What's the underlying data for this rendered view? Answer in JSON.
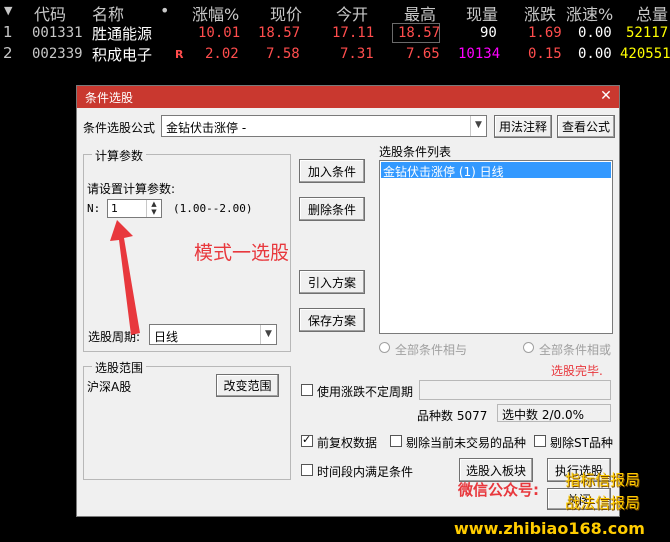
{
  "table": {
    "headers": [
      "代码",
      "名称",
      "•",
      "涨幅%",
      "现价",
      "今开",
      "最高",
      "现量",
      "涨跌",
      "涨速%",
      "总量"
    ],
    "rows": [
      {
        "idx": "1",
        "code": "001331",
        "name": "胜通能源",
        "flag": "",
        "pct": "10.01",
        "price": "18.57",
        "open": "17.11",
        "high": "18.57",
        "vol": "90",
        "chg": "1.69",
        "speed": "0.00",
        "total": "52117"
      },
      {
        "idx": "2",
        "code": "002339",
        "name": "积成电子",
        "flag": "R",
        "pct": "2.02",
        "price": "7.58",
        "open": "7.31",
        "high": "7.65",
        "vol": "10134",
        "chg": "0.15",
        "speed": "0.00",
        "total": "420551"
      }
    ]
  },
  "dialog": {
    "title": "条件选股",
    "formula_label": "条件选股公式",
    "formula_value": "金钻伏击涨停 -",
    "usage_button": "用法注释",
    "view_button": "查看公式",
    "params_group": "计算参数",
    "params_prompt": "请设置计算参数:",
    "param_n_label": "N:",
    "param_n_value": "1",
    "param_n_range": "(1.00--2.00)",
    "add_button": "加入条件",
    "delete_button": "删除条件",
    "import_button": "引入方案",
    "save_button": "保存方案",
    "list_label": "选股条件列表",
    "conditions": [
      "金钻伏击涨停 (1) 日线"
    ],
    "period_label": "选股周期:",
    "period_value": "日线",
    "range_group": "选股范围",
    "range_value": "沪深A股",
    "change_range_button": "改变范围",
    "radio_and": "全部条件相与",
    "radio_or": "全部条件相或",
    "status": "选股完毕.",
    "use_var_period": "使用涨跌不定周期",
    "count_label": "品种数 5077",
    "selected_label": "选中数 2/0.0%",
    "pre_adjust": "前复权数据",
    "exclude_untraded": "剔除当前未交易的品种",
    "exclude_st": "剔除ST品种",
    "time_period": "时间段内满足条件",
    "to_block_button": "选股入板块",
    "run_button": "执行选股",
    "close_button": "关闭"
  },
  "annotation": {
    "text": "模式一选股",
    "color": "#e8383d"
  },
  "watermark": {
    "wechat": "微信公众号:",
    "brand1": "指标信报局",
    "brand2": "战法信报局",
    "url": "www.zhibiao168.com"
  },
  "colors": {
    "up": "#ff4d4d",
    "magenta": "#ff00ff",
    "highlight": "#3399ff",
    "stock_name": "#ffffff",
    "accent": "#c9382f"
  }
}
